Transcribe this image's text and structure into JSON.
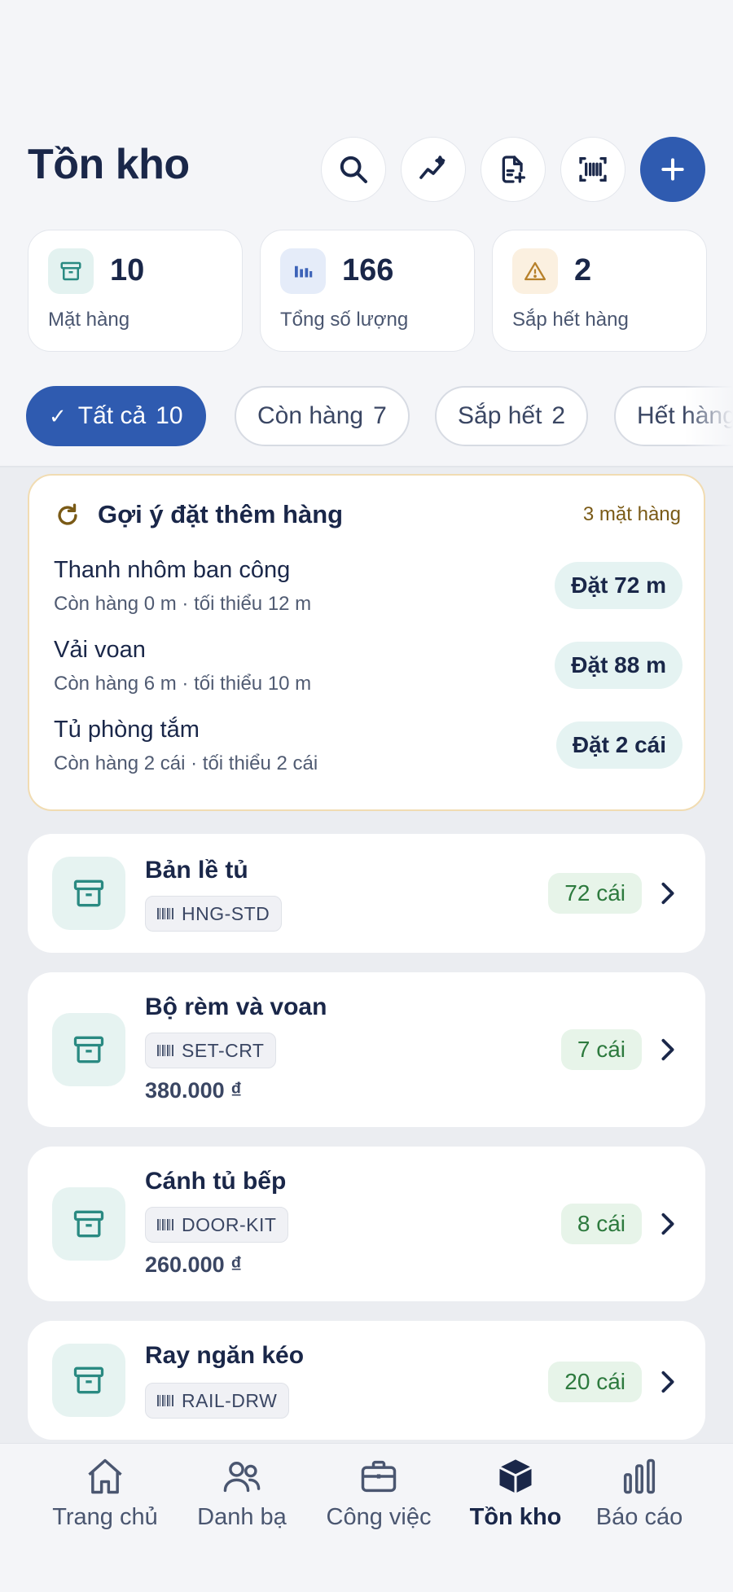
{
  "header": {
    "title": "Tồn kho",
    "buttons": [
      {
        "name": "search-button",
        "icon": "search-icon"
      },
      {
        "name": "analytics-button",
        "icon": "sparkle-trend-icon"
      },
      {
        "name": "add-document-button",
        "icon": "document-plus-icon"
      },
      {
        "name": "barcode-scan-button",
        "icon": "barcode-icon"
      },
      {
        "name": "add-item-button",
        "icon": "plus-icon"
      }
    ]
  },
  "stats": [
    {
      "value": "10",
      "label": "Mặt hàng",
      "icon": "archive-icon",
      "color": "#2a8a82"
    },
    {
      "value": "166",
      "label": "Tổng số lượng",
      "icon": "bars-icon",
      "color": "#3d63b8"
    },
    {
      "value": "2",
      "label": "Sắp hết hàng",
      "icon": "warning-icon",
      "color": "#b7812b"
    }
  ],
  "filters": [
    {
      "label": "Tất cả",
      "count": "10",
      "active": true
    },
    {
      "label": "Còn hàng",
      "count": "7"
    },
    {
      "label": "Sắp hết",
      "count": "2"
    },
    {
      "label": "Hết hàng",
      "count": ""
    }
  ],
  "suggestions": {
    "title": "Gợi ý đặt thêm hàng",
    "count": "3 mặt hàng",
    "items": [
      {
        "name": "Thanh nhôm ban công",
        "detail": "Còn hàng 0 m · tối thiểu 12 m",
        "action": "Đặt 72 m"
      },
      {
        "name": "Vải voan",
        "detail": "Còn hàng 6 m · tối thiểu 10 m",
        "action": "Đặt 88 m"
      },
      {
        "name": "Tủ phòng tắm",
        "detail": "Còn hàng 2 cái · tối thiểu 2 cái",
        "action": "Đặt 2 cái"
      }
    ]
  },
  "products": [
    {
      "name": "Bản lề tủ",
      "sku": "HNG-STD",
      "price": "",
      "qty": "72 cái"
    },
    {
      "name": "Bộ rèm và voan",
      "sku": "SET-CRT",
      "price": "380.000 ₫",
      "qty": "7 cái"
    },
    {
      "name": "Cánh tủ bếp",
      "sku": "DOOR-KIT",
      "price": "260.000 ₫",
      "qty": "8 cái"
    },
    {
      "name": "Ray ngăn kéo",
      "sku": "RAIL-DRW",
      "price": "",
      "qty": "20 cái"
    }
  ],
  "tabbar": [
    {
      "label": "Trang chủ",
      "icon": "home-icon"
    },
    {
      "label": "Danh bạ",
      "icon": "contacts-icon"
    },
    {
      "label": "Công việc",
      "icon": "briefcase-icon"
    },
    {
      "label": "Tồn kho",
      "icon": "box-icon",
      "active": true
    },
    {
      "label": "Báo cáo",
      "icon": "chart-icon"
    }
  ],
  "colors": {
    "primary": "#2f5bb0",
    "teal": "#2a8a82",
    "success": "#2d7a3e",
    "warning": "#b7812b"
  }
}
